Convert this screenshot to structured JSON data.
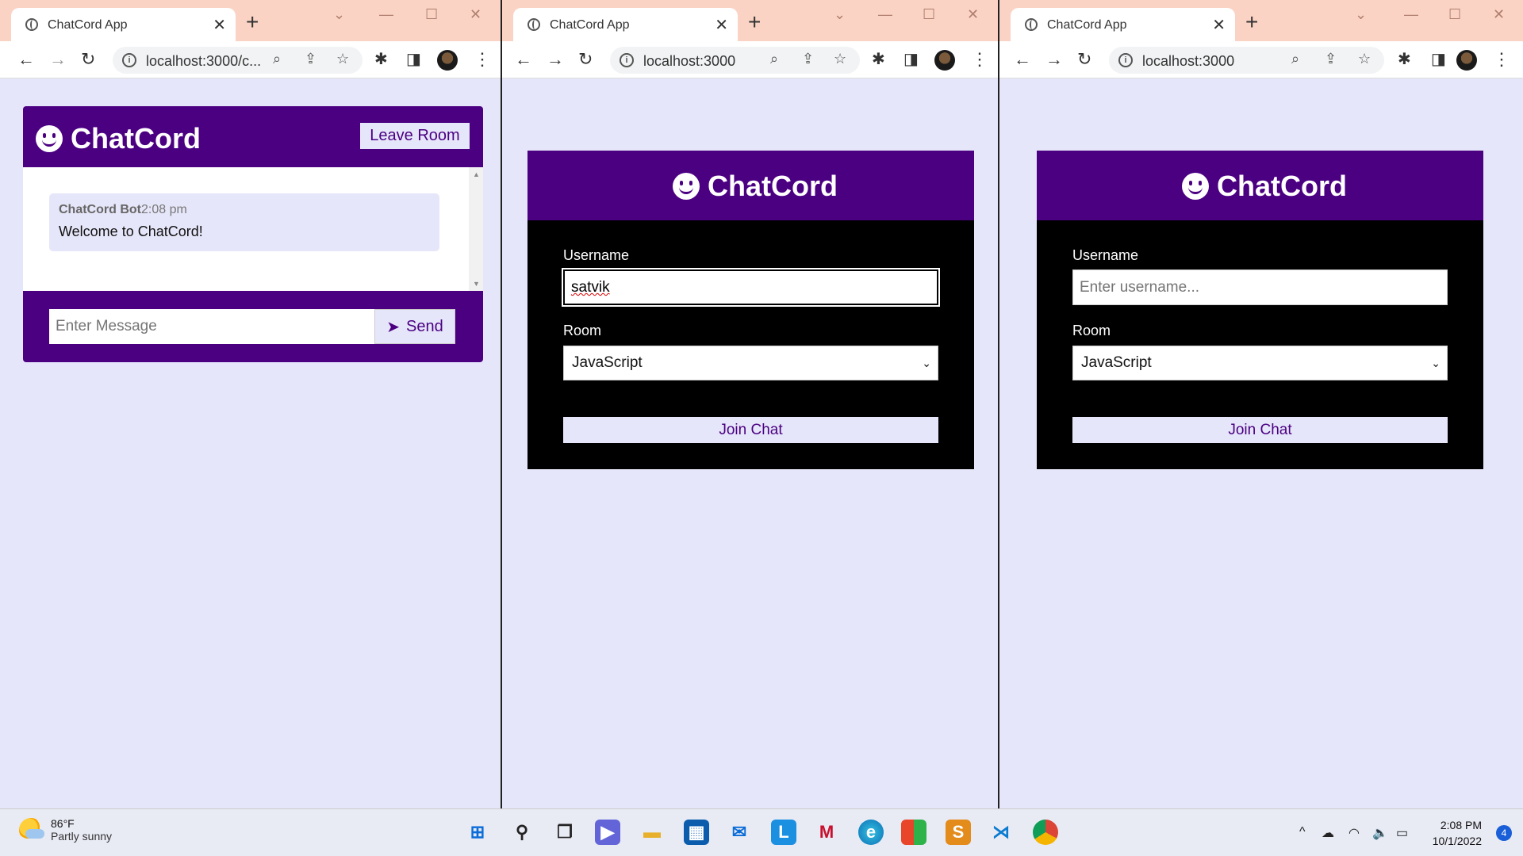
{
  "windows": [
    {
      "tab_title": "ChatCord App",
      "url": "localhost:3000/c...",
      "app": {
        "brand": "ChatCord",
        "leave_label": "Leave Room",
        "messages": [
          {
            "username": "ChatCord Bot",
            "time": "2:08 pm",
            "text": "Welcome to ChatCord!"
          }
        ],
        "message_placeholder": "Enter Message",
        "send_label": "Send"
      }
    },
    {
      "tab_title": "ChatCord App",
      "url": "localhost:3000",
      "app": {
        "brand": "ChatCord",
        "username_label": "Username",
        "username_value": "satvik",
        "username_placeholder": "Enter username...",
        "room_label": "Room",
        "room_value": "JavaScript",
        "join_label": "Join Chat"
      }
    },
    {
      "tab_title": "ChatCord App",
      "url": "localhost:3000",
      "app": {
        "brand": "ChatCord",
        "username_label": "Username",
        "username_value": "",
        "username_placeholder": "Enter username...",
        "room_label": "Room",
        "room_value": "JavaScript",
        "join_label": "Join Chat"
      }
    }
  ],
  "taskbar": {
    "weather_temp": "86°F",
    "weather_desc": "Partly sunny",
    "time": "2:08 PM",
    "date": "10/1/2022",
    "notification_count": "4",
    "pinned_apps": [
      "start-icon",
      "search-icon",
      "task-view-icon",
      "chat-icon",
      "file-explorer-icon",
      "store-icon",
      "mail-icon",
      "l-app-icon",
      "mcafee-icon",
      "edge-icon",
      "office-icon",
      "sublime-icon",
      "vscode-icon",
      "chrome-icon"
    ]
  },
  "colors": {
    "brand_purple": "#4b0082",
    "lavender": "#e6e6fa",
    "tab_bar": "#fbd3c4"
  }
}
